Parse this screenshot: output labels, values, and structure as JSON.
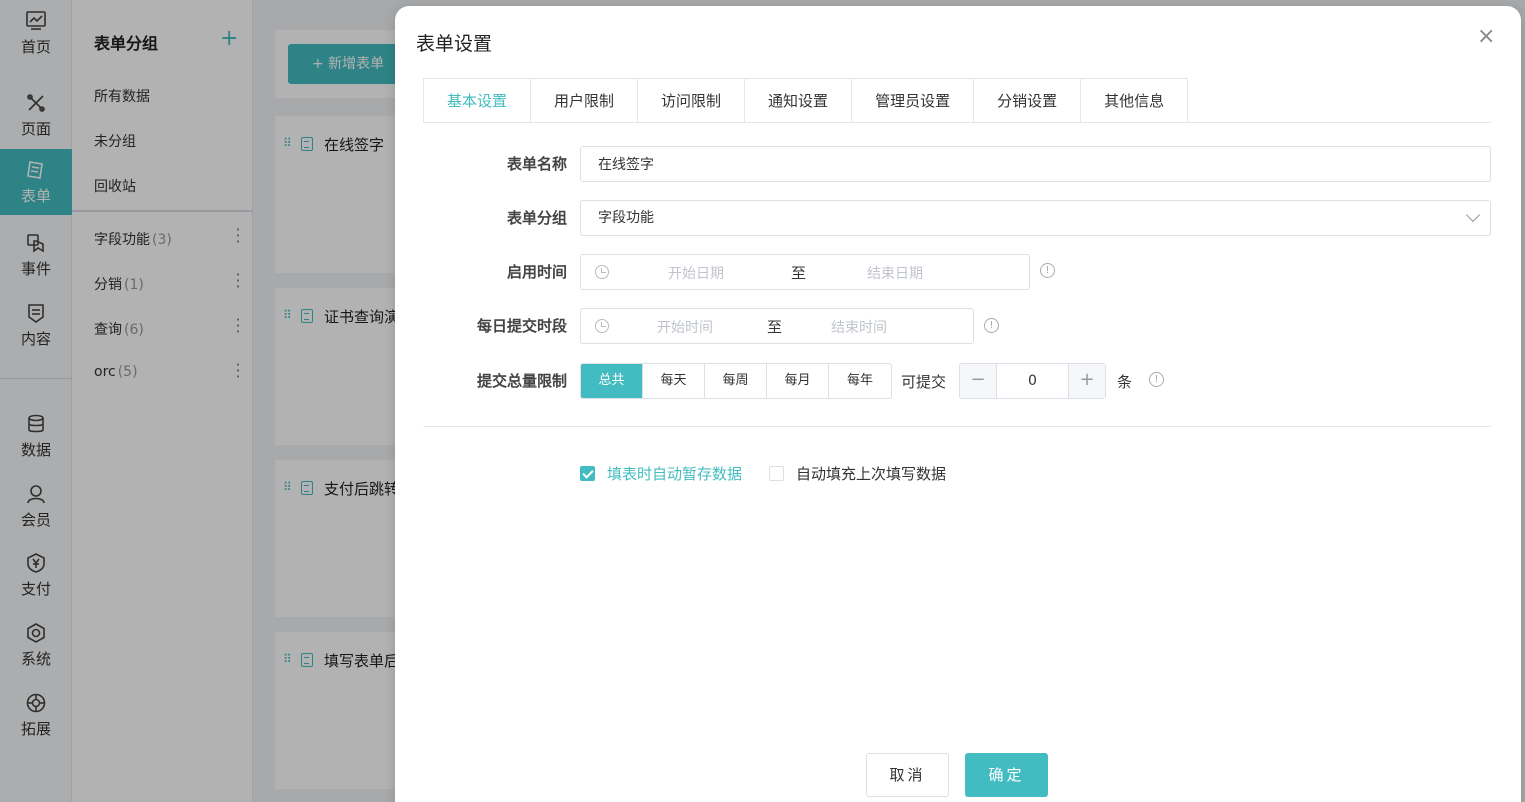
{
  "nav": {
    "items": [
      {
        "label": "首页",
        "icon": "chart-icon"
      },
      {
        "label": "页面",
        "icon": "tools-icon"
      },
      {
        "label": "表单",
        "icon": "form-icon"
      },
      {
        "label": "事件",
        "icon": "touch-icon"
      },
      {
        "label": "内容",
        "icon": "content-icon"
      },
      {
        "label": "数据",
        "icon": "database-icon"
      },
      {
        "label": "会员",
        "icon": "user-icon"
      },
      {
        "label": "支付",
        "icon": "yen-icon"
      },
      {
        "label": "系统",
        "icon": "gear-icon"
      },
      {
        "label": "拓展",
        "icon": "extend-icon"
      }
    ],
    "active": "表单"
  },
  "groups": {
    "title": "表单分组",
    "add": "+",
    "links": [
      "所有数据",
      "未分组",
      "回收站"
    ],
    "rows": [
      {
        "name": "字段功能",
        "count": "(3)"
      },
      {
        "name": "分销",
        "count": "(1)"
      },
      {
        "name": "查询",
        "count": "(6)"
      },
      {
        "name": "orc",
        "count": "(5)"
      }
    ]
  },
  "list": {
    "new_button": "+ 新增表单",
    "cards": [
      "在线签字",
      "证书查询演",
      "支付后跳转",
      "填写表单后"
    ]
  },
  "dialog": {
    "title": "表单设置",
    "close": "×",
    "tabs": [
      "基本设置",
      "用户限制",
      "访问限制",
      "通知设置",
      "管理员设置",
      "分销设置",
      "其他信息"
    ],
    "active_tab": "基本设置",
    "fields": {
      "name_label": "表单名称",
      "name_value": "在线签字",
      "group_label": "表单分组",
      "group_value": "字段功能",
      "enable_label": "启用时间",
      "enable_start": "开始日期",
      "enable_to": "至",
      "enable_end": "结束日期",
      "daily_label": "每日提交时段",
      "daily_start": "开始时间",
      "daily_to": "至",
      "daily_end": "结束时间",
      "limit_label": "提交总量限制",
      "limit_options": [
        "总共",
        "每天",
        "每周",
        "每月",
        "每年"
      ],
      "limit_selected": "总共",
      "can_submit": "可提交",
      "limit_value": "0",
      "unit": "条",
      "info": "!"
    },
    "checkboxes": [
      {
        "label": "填表时自动暂存数据",
        "checked": true
      },
      {
        "label": "自动填充上次填写数据",
        "checked": false
      }
    ],
    "buttons": {
      "cancel": "取消",
      "ok": "确定"
    }
  },
  "colors": {
    "accent": "#43bcc1"
  }
}
